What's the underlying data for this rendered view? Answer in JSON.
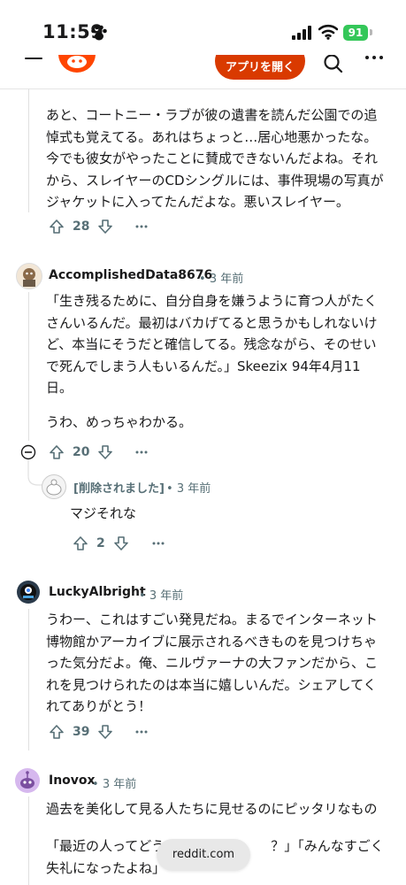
{
  "status_bar": {
    "time": "11:59",
    "battery": "91"
  },
  "header": {
    "open_app_label": "アプリを開く"
  },
  "comments": {
    "c0": {
      "text": "あと、コートニー・ラブが彼の遺書を読んだ公園での追悼式も覚えてる。あれはちょっと…居心地悪かったな。今でも彼女がやったことに賛成できないんだよね。それから、スレイヤーのCDシングルには、事件現場の写真がジャケットに入ってたんだよな。悪いスレイヤー。",
      "votes": "28"
    },
    "c1": {
      "author": "AccomplishedData8676",
      "time": "3 年前",
      "text1": "「生き残るために、自分自身を嫌うように育つ人がたくさんいるんだ。最初はバカげてると思うかもしれないけど、本当にそうだと確信してる。残念ながら、そのせいで死んでしまう人もいるんだ。」Skeezix 94年4月11日。",
      "text2": "うわ、めっちゃわかる。",
      "votes": "20"
    },
    "c2": {
      "author": "[削除されました]",
      "time": "3 年前",
      "text": "マジそれな",
      "votes": "2"
    },
    "c3": {
      "author": "LuckyAlbright",
      "time": "3 年前",
      "text": "うわー、これはすごい発見だね。まるでインターネット博物館かアーカイブに展示されるべきものを見つけちゃった気分だよ。俺、ニルヴァーナの大ファンだから、これを見つけられたのは本当に嬉しいんだ。シェアしてくれてありがとう！",
      "votes": "39"
    },
    "c4": {
      "author": "Inovox",
      "time": "3 年前",
      "text1": "過去を美化して見る人たちに見せるのにピッタリなもの",
      "text2": "「最近の人ってどう　　　　　　　　？」「みんなすごく失礼になったよね」"
    }
  },
  "footer": {
    "domain": "reddit.com"
  }
}
